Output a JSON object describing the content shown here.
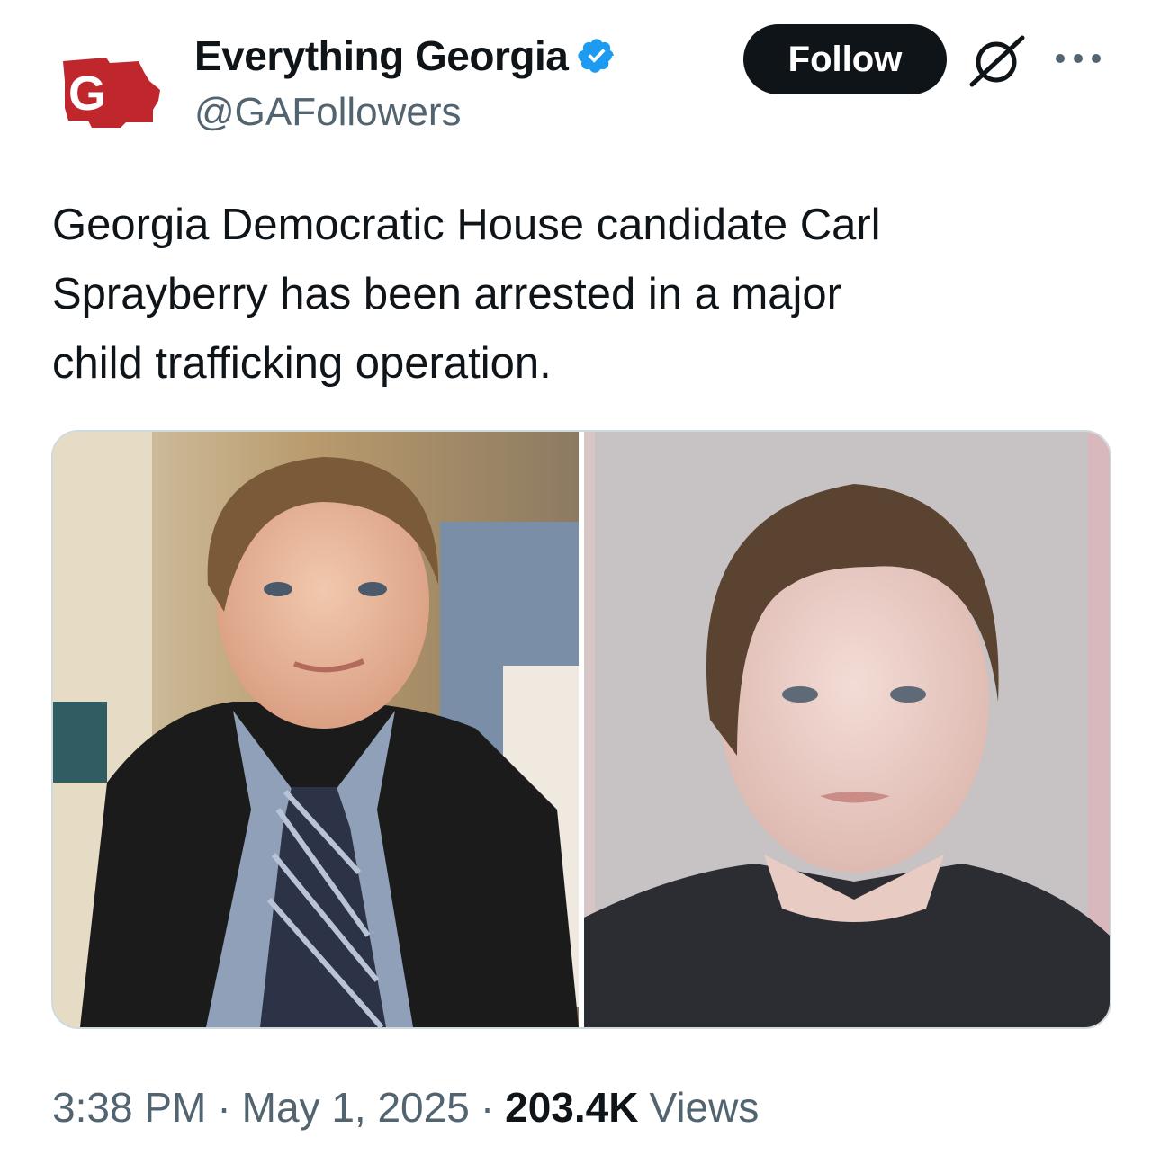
{
  "account": {
    "display_name": "Everything Georgia",
    "handle": "@GAFollowers",
    "avatar_icon": "georgia-map-logo-icon",
    "avatar_logo_text": "G",
    "verified": true,
    "verified_color": "#1d9bf0",
    "brand_color": "#c0272d"
  },
  "actions": {
    "follow_label": "Follow",
    "grok_icon": "grok-icon",
    "more_icon": "more-options-icon"
  },
  "tweet": {
    "text": "Georgia Democratic House candidate Carl\nSprayberry has been arrested in a major\nchild trafficking operation."
  },
  "media": {
    "images": [
      {
        "name": "photo-suit-portrait"
      },
      {
        "name": "photo-mugshot"
      }
    ]
  },
  "meta": {
    "time": "3:38 PM",
    "separator": "·",
    "date": "May 1, 2025",
    "views_count": "203.4K",
    "views_label": "Views"
  }
}
